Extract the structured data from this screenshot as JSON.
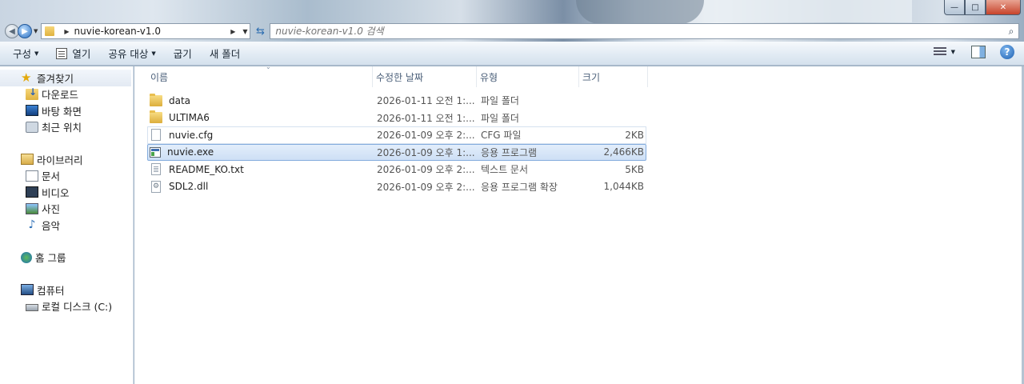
{
  "window": {
    "min_glyph": "—",
    "max_glyph": "□",
    "close_glyph": "✕"
  },
  "address": {
    "path": "nuvie-korean-v1.0",
    "search_placeholder": "nuvie-korean-v1.0 검색"
  },
  "toolbar": {
    "organize": "구성",
    "open": "열기",
    "share": "공유 대상",
    "burn": "굽기",
    "new_folder": "새 폴더",
    "help": "?"
  },
  "sidebar": {
    "favorites": "즐겨찾기",
    "downloads": "다운로드",
    "desktop": "바탕 화면",
    "recent": "최근 위치",
    "libraries": "라이브러리",
    "documents": "문서",
    "videos": "비디오",
    "pictures": "사진",
    "music": "음악",
    "homegroup": "홈 그룹",
    "computer": "컴퓨터",
    "local_disk": "로컬 디스크 (C:)"
  },
  "columns": {
    "name": "이름",
    "date": "수정한 날짜",
    "type": "유형",
    "size": "크기"
  },
  "files": [
    {
      "name": "data",
      "date": "2026-01-11 오전 1:...",
      "type": "파일 폴더",
      "size": ""
    },
    {
      "name": "ULTIMA6",
      "date": "2026-01-11 오전 1:...",
      "type": "파일 폴더",
      "size": ""
    },
    {
      "name": "nuvie.cfg",
      "date": "2026-01-09 오후 2:...",
      "type": "CFG 파일",
      "size": "2KB"
    },
    {
      "name": "nuvie.exe",
      "date": "2026-01-09 오후 1:...",
      "type": "응용 프로그램",
      "size": "2,466KB"
    },
    {
      "name": "README_KO.txt",
      "date": "2026-01-09 오후 2:...",
      "type": "텍스트 문서",
      "size": "5KB"
    },
    {
      "name": "SDL2.dll",
      "date": "2026-01-09 오후 2:...",
      "type": "응용 프로그램 확장",
      "size": "1,044KB"
    }
  ],
  "selected_file": "nuvie.exe"
}
